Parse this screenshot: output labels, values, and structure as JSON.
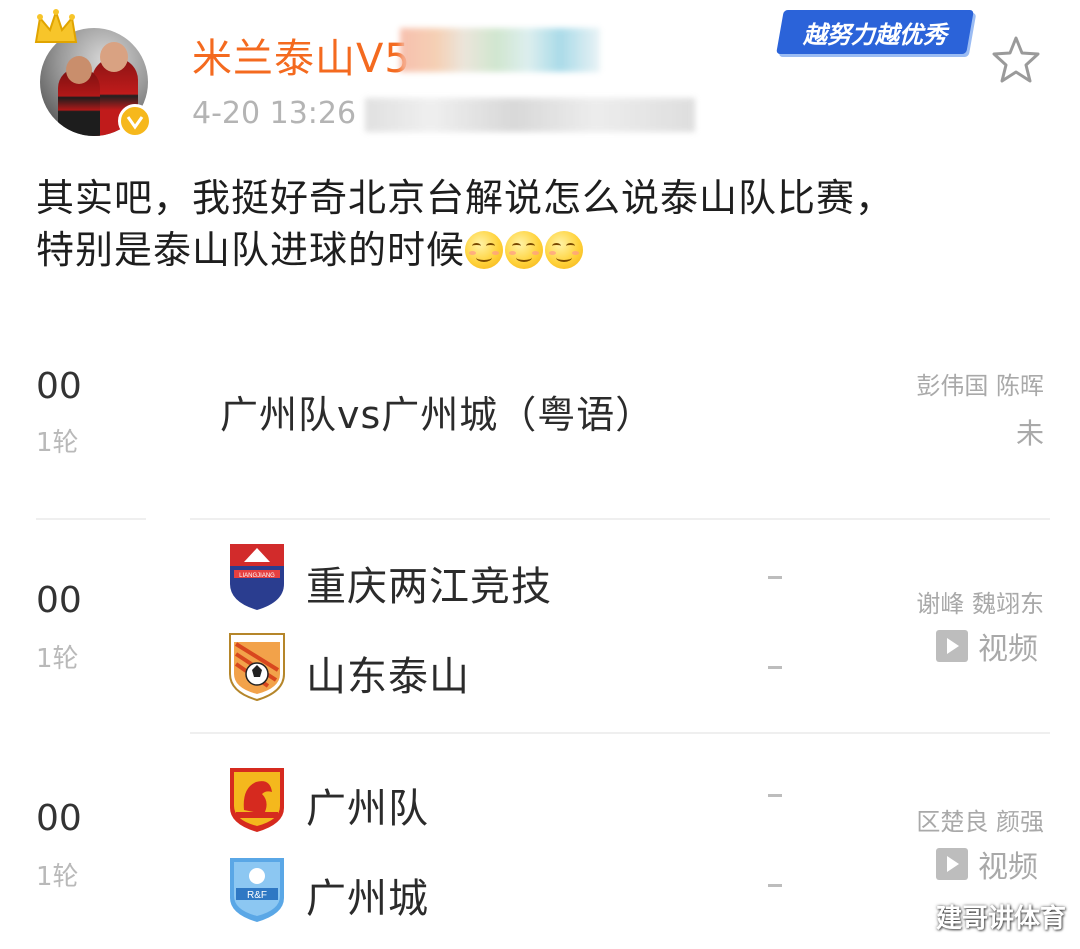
{
  "post": {
    "username": "米兰泰山V5",
    "timestamp": "4-20 13:26",
    "slogan": "越努力越优秀",
    "text_line1": "其实吧，我挺好奇北京台解说怎么说泰山队比赛，",
    "text_line2": "特别是泰山队进球的时候",
    "emoji_count": 3,
    "colors": {
      "username": "#f46a1f",
      "badge": "#f6b81c",
      "slogan_bg": "#2b63d9"
    }
  },
  "schedule": {
    "matches": [
      {
        "time": "00",
        "round": "1轮",
        "title": "广州队vs广州城（粤语）",
        "commentators": "彭伟国 陈晖",
        "status": "未"
      },
      {
        "time": "00",
        "round": "1轮",
        "home": {
          "name": "重庆两江竞技",
          "logo": "chongqing-crest",
          "score": "-"
        },
        "away": {
          "name": "山东泰山",
          "logo": "shandong-crest",
          "score": "-"
        },
        "commentators": "谢峰 魏翊东",
        "action": "视频"
      },
      {
        "time": "00",
        "round": "1轮",
        "home": {
          "name": "广州队",
          "logo": "guangzhou-crest",
          "score": "-"
        },
        "away": {
          "name": "广州城",
          "logo": "guangzhou-city-crest",
          "score": "-"
        },
        "commentators": "区楚良 颜强",
        "action": "视频"
      }
    ]
  },
  "watermark": "建哥讲体育"
}
